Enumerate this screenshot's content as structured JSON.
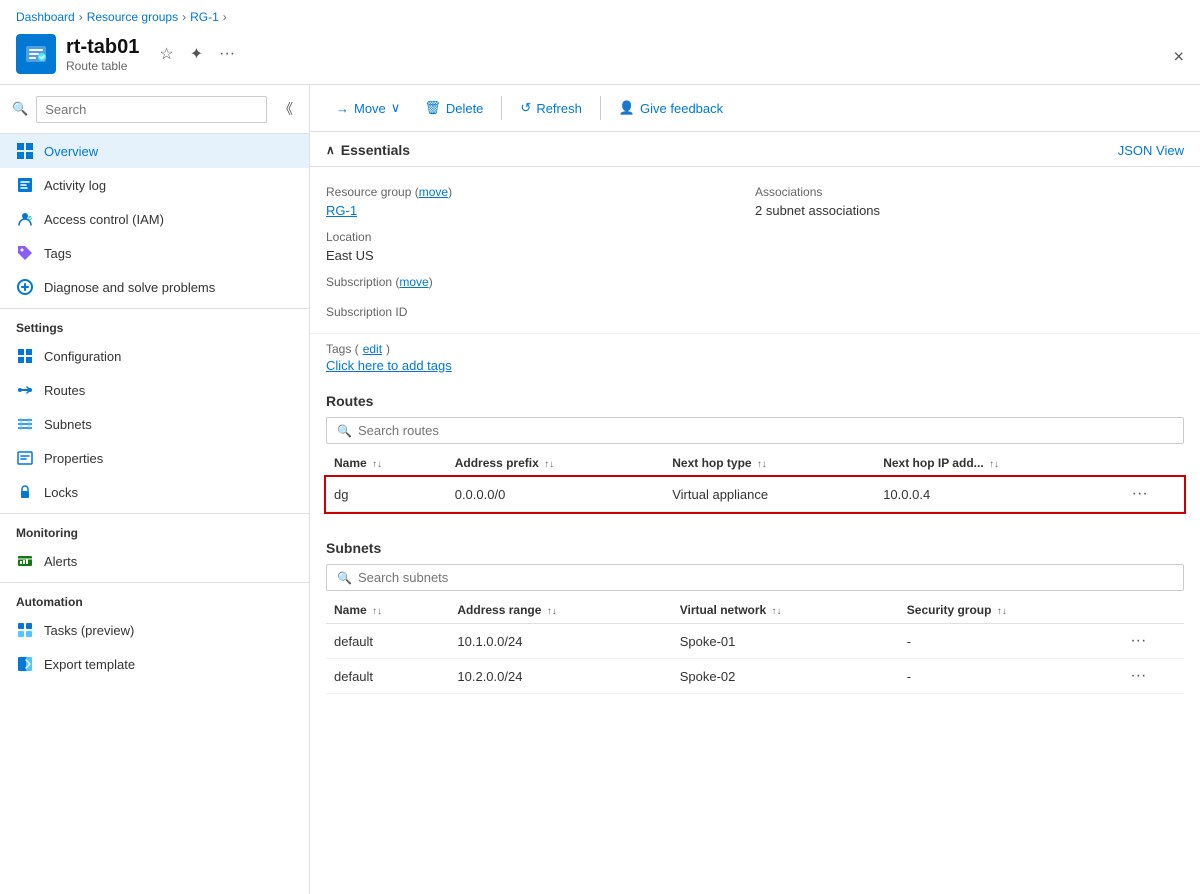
{
  "breadcrumb": {
    "items": [
      "Dashboard",
      "Resource groups",
      "RG-1"
    ]
  },
  "header": {
    "title": "rt-tab01",
    "subtitle": "Route table",
    "close_label": "×"
  },
  "sidebar": {
    "search_placeholder": "Search",
    "nav_items": [
      {
        "id": "overview",
        "label": "Overview",
        "icon": "overview",
        "active": true,
        "section": null
      },
      {
        "id": "activity-log",
        "label": "Activity log",
        "icon": "activity",
        "active": false,
        "section": null
      },
      {
        "id": "access-control",
        "label": "Access control (IAM)",
        "icon": "iam",
        "active": false,
        "section": null
      },
      {
        "id": "tags",
        "label": "Tags",
        "icon": "tags",
        "active": false,
        "section": null
      },
      {
        "id": "diagnose",
        "label": "Diagnose and solve problems",
        "icon": "diagnose",
        "active": false,
        "section": null
      }
    ],
    "sections": [
      {
        "title": "Settings",
        "items": [
          {
            "id": "configuration",
            "label": "Configuration",
            "icon": "config"
          },
          {
            "id": "routes",
            "label": "Routes",
            "icon": "routes"
          },
          {
            "id": "subnets",
            "label": "Subnets",
            "icon": "subnets"
          },
          {
            "id": "properties",
            "label": "Properties",
            "icon": "properties"
          },
          {
            "id": "locks",
            "label": "Locks",
            "icon": "locks"
          }
        ]
      },
      {
        "title": "Monitoring",
        "items": [
          {
            "id": "alerts",
            "label": "Alerts",
            "icon": "alerts"
          }
        ]
      },
      {
        "title": "Automation",
        "items": [
          {
            "id": "tasks",
            "label": "Tasks (preview)",
            "icon": "tasks"
          },
          {
            "id": "export",
            "label": "Export template",
            "icon": "export"
          }
        ]
      }
    ]
  },
  "toolbar": {
    "move_label": "Move",
    "delete_label": "Delete",
    "refresh_label": "Refresh",
    "feedback_label": "Give feedback"
  },
  "essentials": {
    "title": "Essentials",
    "json_view_label": "JSON View",
    "resource_group_label": "Resource group (move)",
    "resource_group_value": "RG-1",
    "location_label": "Location",
    "location_value": "East US",
    "subscription_label": "Subscription (move)",
    "subscription_value": "",
    "subscription_id_label": "Subscription ID",
    "subscription_id_value": "",
    "associations_label": "Associations",
    "associations_value": "2 subnet associations",
    "tags_label": "Tags",
    "tags_edit": "edit",
    "tags_add": "Click here to add tags"
  },
  "routes": {
    "title": "Routes",
    "search_placeholder": "Search routes",
    "columns": [
      "Name",
      "Address prefix",
      "Next hop type",
      "Next hop IP add..."
    ],
    "rows": [
      {
        "name": "dg",
        "address_prefix": "0.0.0.0/0",
        "next_hop_type": "Virtual appliance",
        "next_hop_ip": "10.0.0.4",
        "selected": true
      }
    ]
  },
  "subnets": {
    "title": "Subnets",
    "search_placeholder": "Search subnets",
    "columns": [
      "Name",
      "Address range",
      "Virtual network",
      "Security group"
    ],
    "rows": [
      {
        "name": "default",
        "address_range": "10.1.0.0/24",
        "virtual_network": "Spoke-01",
        "security_group": "-"
      },
      {
        "name": "default",
        "address_range": "10.2.0.0/24",
        "virtual_network": "Spoke-02",
        "security_group": "-"
      }
    ]
  }
}
